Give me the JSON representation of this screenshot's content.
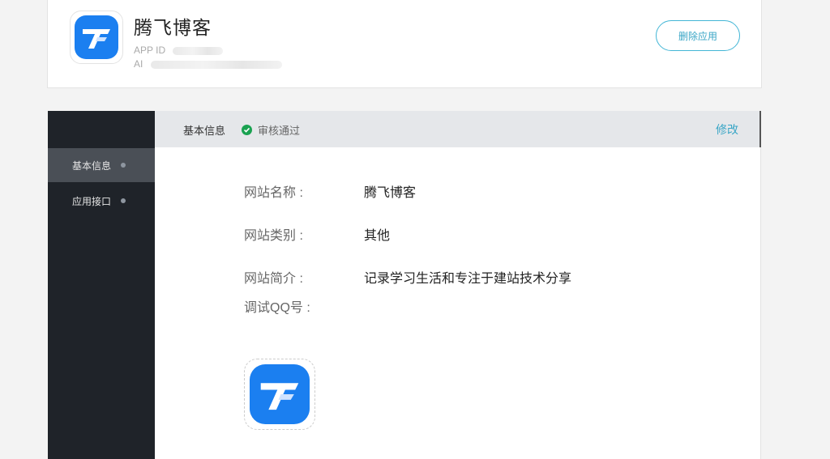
{
  "app": {
    "name": "腾飞博客",
    "app_id_label": "APP ID",
    "app_key_label": "AI",
    "delete_button": "删除应用"
  },
  "sidebar": {
    "items": [
      {
        "label": "基本信息",
        "active": true
      },
      {
        "label": "应用接口",
        "active": false
      }
    ]
  },
  "header": {
    "title": "基本信息",
    "status": "审核通过",
    "edit_link": "修改"
  },
  "fields": [
    {
      "label": "网站名称 :",
      "value": "腾飞博客"
    },
    {
      "label": "网站类别 :",
      "value": "其他"
    },
    {
      "label": "网站简介 :",
      "value": "记录学习生活和专注于建站技术分享"
    },
    {
      "label": "调试QQ号 :",
      "value": ""
    }
  ],
  "colors": {
    "accent": "#3aa6c6",
    "sidebar_bg": "#1f2329",
    "status_green": "#1aa251",
    "logo_blue": "#1b7ff0"
  },
  "icons": {
    "logo": "app-logo-icon",
    "status": "check-circle-icon"
  }
}
